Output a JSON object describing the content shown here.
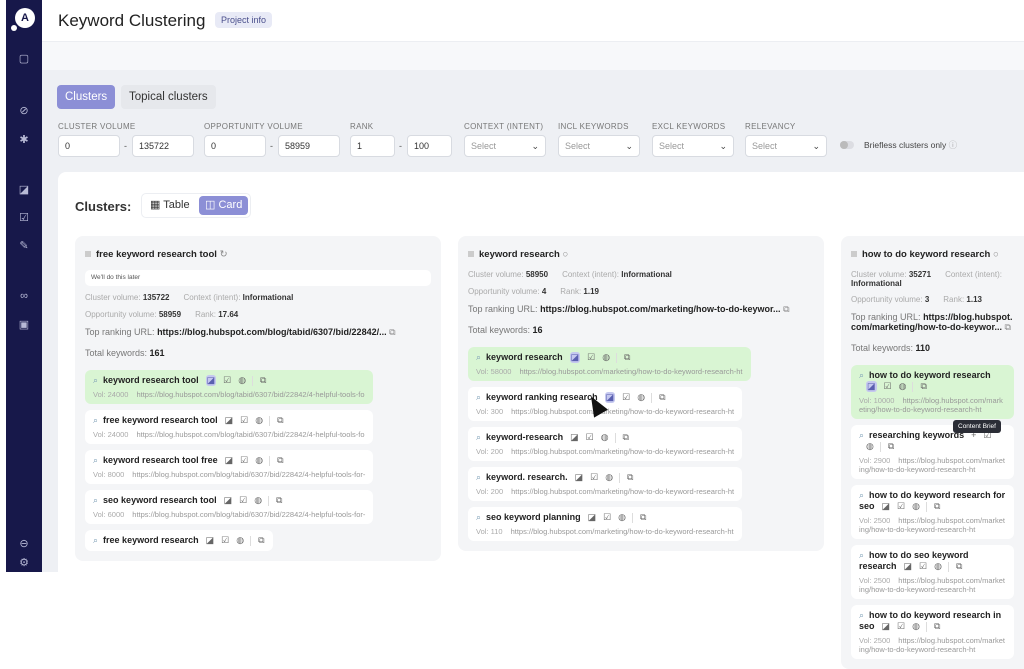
{
  "app": {
    "title": "Keyword Clustering",
    "project_info": "Project info",
    "logo": "A"
  },
  "sidebar": {
    "icons": [
      "file-icon",
      "compass-icon",
      "star-icon",
      "brief-icon",
      "edit-icon",
      "magic-wand-icon",
      "link-icon",
      "message-icon",
      "collapse-icon",
      "settings-icon"
    ]
  },
  "tabs": [
    {
      "label": "Clusters",
      "active": true
    },
    {
      "label": "Topical clusters",
      "active": false
    }
  ],
  "filters": {
    "cluster_volume": {
      "label": "CLUSTER VOLUME",
      "min": "0",
      "max": "135722"
    },
    "opportunity_volume": {
      "label": "OPPORTUNITY VOLUME",
      "min": "0",
      "max": "58959"
    },
    "rank": {
      "label": "RANK",
      "min": "1",
      "max": "100"
    },
    "context": {
      "label": "CONTEXT (INTENT)",
      "placeholder": "Select"
    },
    "incl": {
      "label": "INCL KEYWORDS",
      "placeholder": "Select"
    },
    "excl": {
      "label": "EXCL KEYWORDS",
      "placeholder": "Select"
    },
    "relevancy": {
      "label": "RELEVANCY",
      "placeholder": "Select"
    },
    "briefless": {
      "label": "Briefless clusters only",
      "on": false
    }
  },
  "view": {
    "title": "Clusters:",
    "table": "Table",
    "card": "Card",
    "active": "Card"
  },
  "labels": {
    "cluster_volume": "Cluster volume:",
    "context": "Context (intent):",
    "opportunity": "Opportunity volume:",
    "rank": "Rank:",
    "top_url": "Top ranking URL:",
    "total": "Total keywords:",
    "vol": "Vol:"
  },
  "tooltip": "Content Brief",
  "colors": {
    "sidebar": "#17184a",
    "accent": "#8c8fd6",
    "highlight": "#d9f5d3"
  },
  "clusters": [
    {
      "name": "free keyword research tool",
      "note": "We'll do this later",
      "cluster_volume": "135722",
      "context": "Informational",
      "opportunity": "58959",
      "rank": "17.64",
      "top_url": "https://blog.hubspot.com/blog/tabid/6307/bid/22842/...",
      "total": "161",
      "keywords": [
        {
          "kw": "keyword research tool",
          "vol": "24000",
          "url": "https://blog.hubspot.com/blog/tabid/6307/bid/22842/4-helpful-tools-fo",
          "hl": true
        },
        {
          "kw": "free keyword research tool",
          "vol": "24000",
          "url": "https://blog.hubspot.com/blog/tabid/6307/bid/22842/4-helpful-tools-fo"
        },
        {
          "kw": "keyword research tool free",
          "vol": "8000",
          "url": "https://blog.hubspot.com/blog/tabid/6307/bid/22842/4-helpful-tools-for-"
        },
        {
          "kw": "seo keyword research tool",
          "vol": "6000",
          "url": "https://blog.hubspot.com/blog/tabid/6307/bid/22842/4-helpful-tools-for-"
        },
        {
          "kw": "free keyword research",
          "vol": "",
          "url": ""
        }
      ]
    },
    {
      "name": "keyword research",
      "cluster_volume": "58950",
      "context": "Informational",
      "opportunity": "4",
      "rank": "1.19",
      "top_url": "https://blog.hubspot.com/marketing/how-to-do-keywor...",
      "total": "16",
      "keywords": [
        {
          "kw": "keyword research",
          "vol": "58000",
          "url": "https://blog.hubspot.com/marketing/how-to-do-keyword-research-ht",
          "hl": true
        },
        {
          "kw": "keyword ranking research",
          "vol": "300",
          "url": "https://blog.hubspot.com/marketing/how-to-do-keyword-research-ht"
        },
        {
          "kw": "keyword-research",
          "vol": "200",
          "url": "https://blog.hubspot.com/marketing/how-to-do-keyword-research-ht"
        },
        {
          "kw": "keyword. research.",
          "vol": "200",
          "url": "https://blog.hubspot.com/marketing/how-to-do-keyword-research-ht"
        },
        {
          "kw": "seo keyword planning",
          "vol": "110",
          "url": "https://blog.hubspot.com/marketing/how-to-do-keyword-research-ht"
        }
      ]
    },
    {
      "name": "how to do keyword research",
      "cluster_volume": "35271",
      "context": "Informational",
      "opportunity": "3",
      "rank": "1.13",
      "top_url": "https://blog.hubspot.com/marketing/how-to-do-keywor...",
      "total": "110",
      "keywords": [
        {
          "kw": "how to do keyword research",
          "vol": "10000",
          "url": "https://blog.hubspot.com/marketing/how-to-do-keyword-research-ht",
          "hl": true
        },
        {
          "kw": "researching keywords",
          "vol": "2900",
          "url": "https://blog.hubspot.com/marketing/how-to-do-keyword-research-ht"
        },
        {
          "kw": "how to do keyword research for seo",
          "vol": "2500",
          "url": "https://blog.hubspot.com/marketing/how-to-do-keyword-research-ht"
        },
        {
          "kw": "how to do seo keyword research",
          "vol": "2500",
          "url": "https://blog.hubspot.com/marketing/how-to-do-keyword-research-ht"
        },
        {
          "kw": "how to do keyword research in seo",
          "vol": "2500",
          "url": "https://blog.hubspot.com/marketing/how-to-do-keyword-research-ht"
        }
      ]
    }
  ]
}
